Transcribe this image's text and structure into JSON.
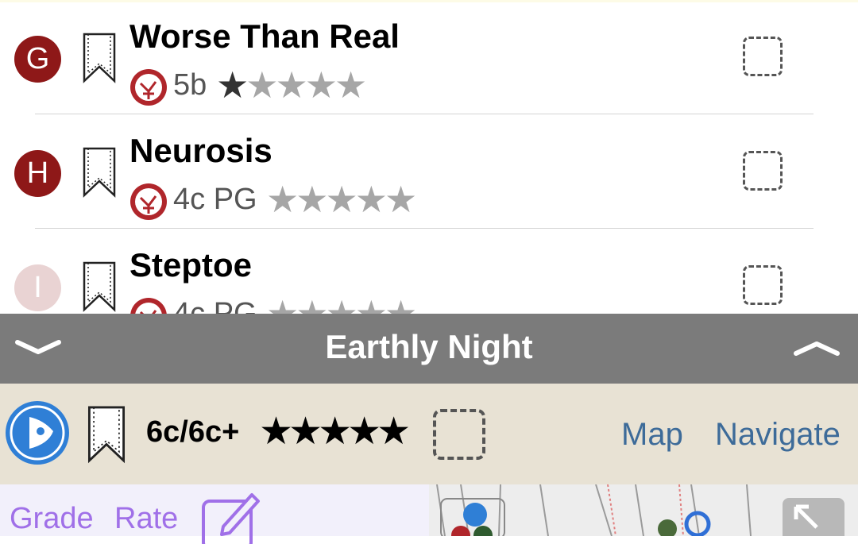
{
  "routes": [
    {
      "letter": "G",
      "name": "Worse Than Real",
      "grade": "5b",
      "stars_filled": 1,
      "stars_total": 5
    },
    {
      "letter": "H",
      "name": "Neurosis",
      "grade": "4c PG",
      "stars_filled": 0,
      "stars_total": 5
    },
    {
      "letter": "I",
      "name": "Steptoe",
      "grade": "4c PG",
      "stars_filled": 0,
      "stars_total": 5
    }
  ],
  "dock": {
    "title": "Earthly Night"
  },
  "selected": {
    "grade": "6c/6c+",
    "stars": "★★★★★",
    "map_label": "Map",
    "navigate_label": "Navigate"
  },
  "bottom": {
    "grade_label": "Grade",
    "rate_label": "Rate"
  },
  "colors": {
    "badge": "#8e1818",
    "link": "#3d6b99",
    "purple": "#a070e8",
    "dock": "#7b7b7b",
    "info_bg": "#e8e2d4"
  }
}
